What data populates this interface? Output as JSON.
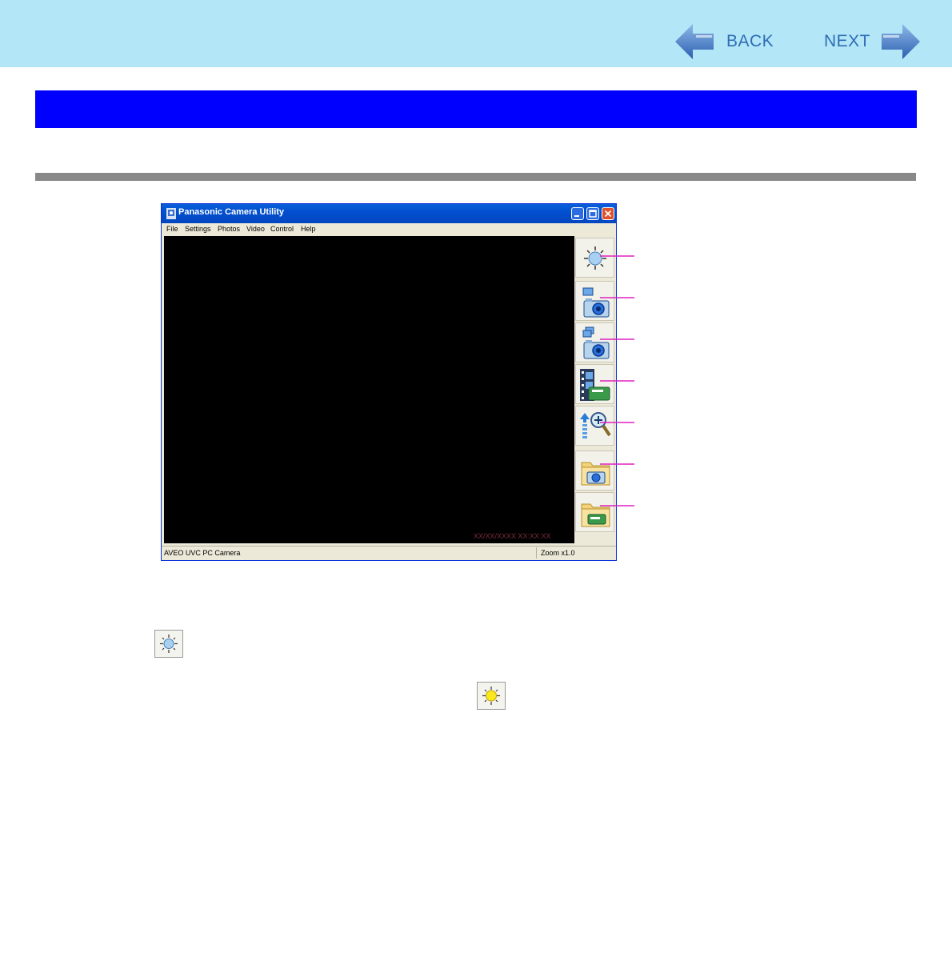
{
  "nav": {
    "back_label": "BACK",
    "next_label": "NEXT"
  },
  "window": {
    "title": "Panasonic Camera Utility",
    "menu": [
      "File",
      "Settings",
      "Photos",
      "Video",
      "Control",
      "Help"
    ],
    "video_timestamp": "XX/XX/XXXX XX:XX:XX",
    "status_left": "AVEO UVC PC Camera",
    "status_right": "Zoom x1.0"
  },
  "toolbar_icons": [
    "light-icon",
    "single-photo-icon",
    "continuous-photo-icon",
    "video-record-icon",
    "zoom-icon",
    "photo-folder-icon",
    "video-folder-icon"
  ],
  "colors": {
    "header_band": "#b3e6f7",
    "title_band": "#0000ff",
    "callout_line": "#e020c0",
    "rule": "#888888",
    "nav_text": "#2f6cb5"
  }
}
